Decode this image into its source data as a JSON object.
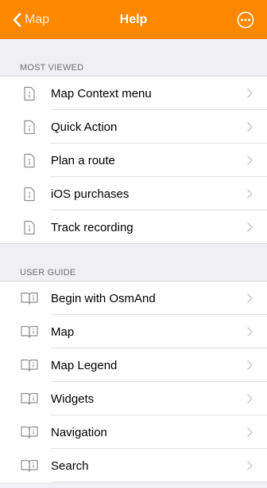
{
  "navbar": {
    "back_label": "Map",
    "title": "Help"
  },
  "sections": [
    {
      "header": "MOST VIEWED",
      "icon": "document-info-icon",
      "items": [
        {
          "label": "Map Context menu"
        },
        {
          "label": "Quick Action"
        },
        {
          "label": "Plan a route"
        },
        {
          "label": "iOS purchases"
        },
        {
          "label": "Track recording"
        }
      ]
    },
    {
      "header": "USER GUIDE",
      "icon": "book-icon",
      "items": [
        {
          "label": "Begin with OsmAnd"
        },
        {
          "label": "Map"
        },
        {
          "label": "Map Legend"
        },
        {
          "label": "Widgets"
        },
        {
          "label": "Navigation"
        },
        {
          "label": "Search"
        }
      ]
    }
  ],
  "colors": {
    "accent": "#ff8800",
    "background": "#efeff4",
    "icon": "#8e8e93"
  }
}
